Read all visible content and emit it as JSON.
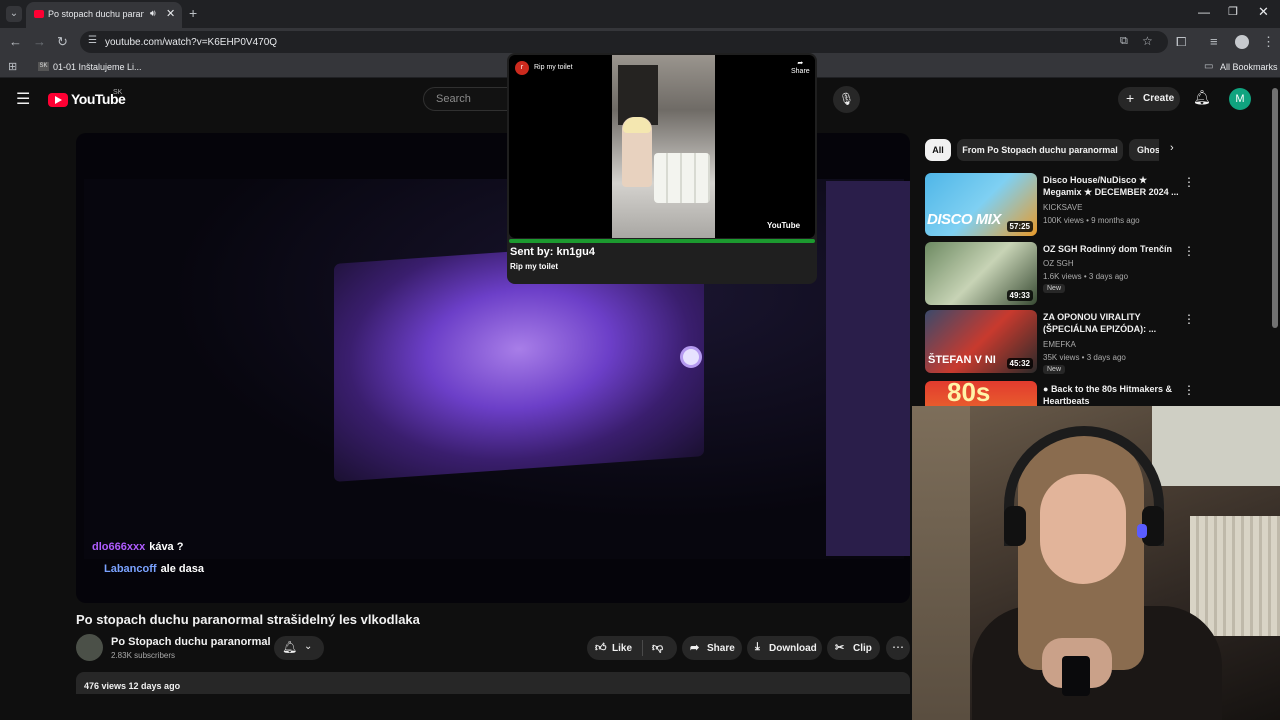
{
  "browser": {
    "tab_title": "Po stopach duchu paranormal",
    "url": "youtube.com/watch?v=K6EHP0V470Q",
    "bookmark_favicon_text": "SK",
    "bookmark_label": "01-01 Inštalujeme Li...",
    "all_bookmarks_label": "All Bookmarks"
  },
  "header": {
    "logo_text": "YouTube",
    "country_code": "SK",
    "search_placeholder": "Search",
    "create_label": "Create",
    "account_initial": "M"
  },
  "video": {
    "title": "Po stopach duchu paranormal strašidelný les vlkodlaka",
    "channel_name": "Po Stopach duchu paranormal",
    "subscribers": "2.83K subscribers",
    "views_and_date": "476 views  12 days ago",
    "actions": {
      "like": "Like",
      "share": "Share",
      "download": "Download",
      "clip": "Clip"
    },
    "chat": [
      {
        "user": "dlo666xxx",
        "message": "káva ?"
      },
      {
        "user": "Labancoff",
        "message": "ale dasa"
      }
    ]
  },
  "alert": {
    "channel_initial": "r",
    "video_title": "Rip my toilet",
    "share_label": "Share",
    "player_logo": "YouTube",
    "sender": "Sent by: kn1gu4",
    "message": "Rip my toilet",
    "progress_fraction": 1.0
  },
  "sidebar": {
    "chips": [
      "All",
      "From Po Stopach duchu paranormal",
      "Ghos"
    ],
    "recommendations": [
      {
        "title": "Disco House/NuDisco ★ Megamix ★ DECEMBER 2024 ...",
        "channel": "KICKSAVE",
        "meta": "100K views • 9 months ago",
        "duration": "57:25",
        "badge": "",
        "thumb_text": "DISCO MIX"
      },
      {
        "title": "OZ SGH Rodinný dom Trenčín",
        "channel": "OZ SGH",
        "meta": "1.6K views • 3 days ago",
        "duration": "49:33",
        "badge": "New",
        "thumb_text": ""
      },
      {
        "title": "ZA OPONOU VIRALITY (ŠPECIÁLNA EPIZÓDA): ...",
        "channel": "EMEFKA",
        "meta": "35K views • 3 days ago",
        "duration": "45:32",
        "badge": "New",
        "thumb_text": "ŠTEFAN V NI"
      },
      {
        "title": "Back to the 80s  Hitmakers & Heartbeats",
        "channel": "",
        "meta": "",
        "duration": "",
        "badge": "",
        "thumb_text": "80s"
      }
    ]
  },
  "colors": {
    "youtube_red": "#ff0033",
    "background": "#0f0f0f",
    "chat_user_1": "#b05cff",
    "chat_user_2": "#7aa2ff",
    "alert_progress": "#1c9a2f",
    "account_avatar": "#10a37f"
  },
  "icons": [
    "tab-list-icon",
    "audio-icon",
    "close-icon",
    "new-tab-icon",
    "back-icon",
    "forward-icon",
    "reload-icon",
    "site-info-icon",
    "install-icon",
    "star-icon",
    "extensions-icon",
    "media-icon",
    "profile-icon",
    "kebab-icon",
    "apps-icon",
    "folder-icon",
    "menu-icon",
    "mic-icon",
    "bell-icon",
    "like-icon",
    "dislike-icon",
    "share-icon",
    "download-icon",
    "clip-icon",
    "chevron-right-icon"
  ]
}
